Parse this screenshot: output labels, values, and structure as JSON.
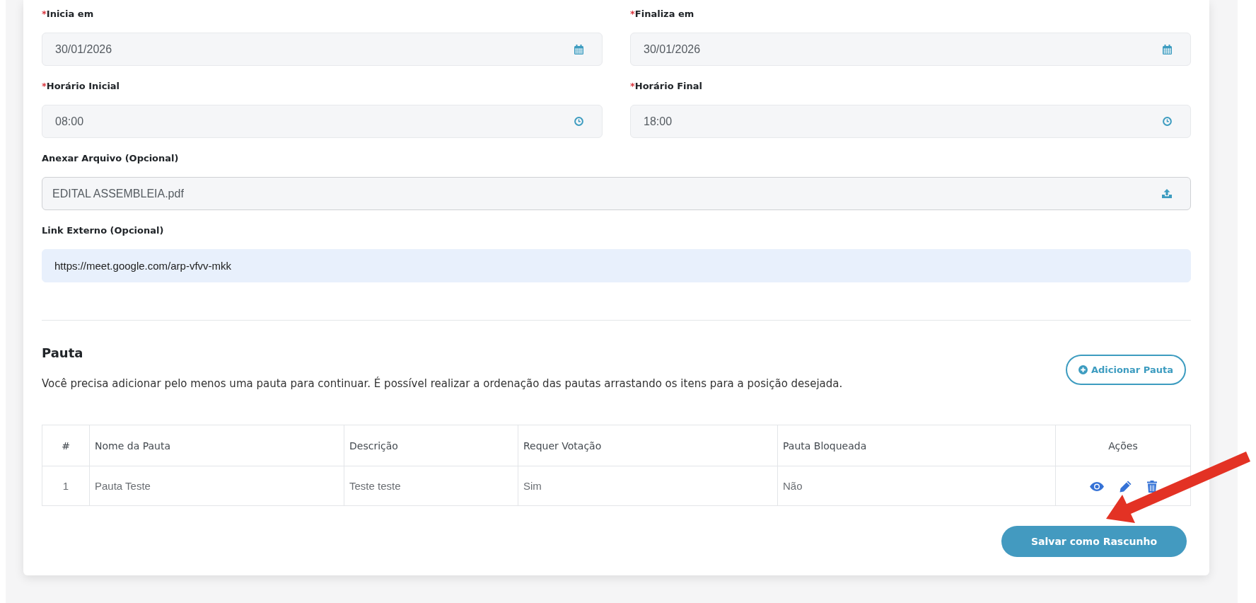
{
  "form": {
    "required_mark": "*",
    "fields": [
      {
        "kind": "date",
        "label": "Inicia em",
        "required": true,
        "value": "30/01/2026",
        "autofilled": false
      },
      {
        "kind": "date",
        "label": "Finaliza em",
        "required": true,
        "value": "30/01/2026",
        "autofilled": false
      },
      {
        "kind": "time",
        "label": "Horário Inicial",
        "required": true,
        "value": "08:00",
        "autofilled": false
      },
      {
        "kind": "time",
        "label": "Horário Final",
        "required": true,
        "value": "18:00",
        "autofilled": false
      },
      {
        "kind": "file",
        "label": "Anexar Arquivo (Opcional)",
        "required": false,
        "value": "EDITAL ASSEMBLEIA.pdf",
        "autofilled": false
      },
      {
        "kind": "link",
        "label": "Link Externo (Opcional)",
        "required": false,
        "value": "https://meet.google.com/arp-vfvv-mkk",
        "autofilled": true
      }
    ]
  },
  "agenda": {
    "title": "Pauta",
    "description": "Você precisa adicionar pelo menos uma pauta para continuar. É possível realizar a ordenação das pautas arrastando os itens para a posição desejada.",
    "add_button": "Adicionar Pauta",
    "table": {
      "columns": [
        "#",
        "Nome da Pauta",
        "Descrição",
        "Requer Votação",
        "Pauta Bloqueada",
        "Ações"
      ],
      "rows": [
        {
          "cells": [
            "1",
            "Pauta Teste",
            "Teste teste",
            "Sim",
            "Não"
          ]
        }
      ]
    }
  },
  "save_button": "Salvar como Rascunho"
}
